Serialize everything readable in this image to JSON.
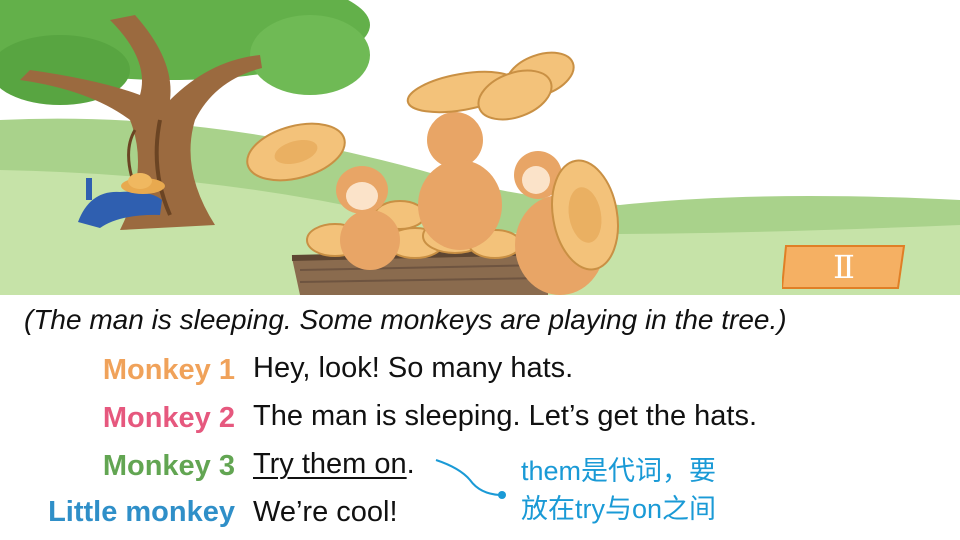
{
  "slide": {
    "badge": "Ⅱ",
    "narration": "(The man is sleeping. Some monkeys are playing in the tree.)",
    "dialogue": [
      {
        "speaker": "Monkey 1",
        "speaker_color": "#f0a25a",
        "text": "Hey, look! So many hats."
      },
      {
        "speaker": "Monkey 2",
        "speaker_color": "#e6587e",
        "text": "The man is sleeping. Let’s get the hats."
      },
      {
        "speaker": "Monkey 3",
        "speaker_color": "#62a552",
        "text_underlined": "Try them on",
        "text_after": "."
      },
      {
        "speaker": "Little monkey",
        "speaker_color": "#2f8fc8",
        "text": "We’re cool!"
      }
    ],
    "note": {
      "line1": "them是代词，要",
      "line2": "放在try与on之间",
      "color": "#1a9ad6"
    }
  }
}
